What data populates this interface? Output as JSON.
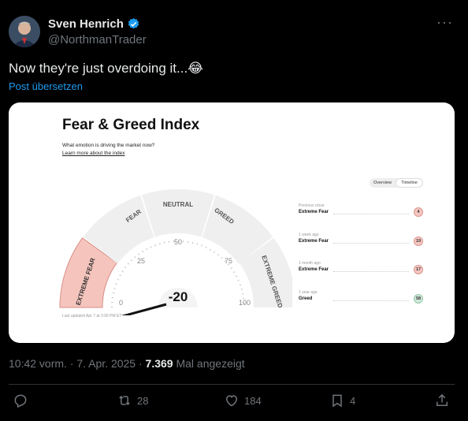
{
  "author": {
    "name": "Sven Henrich",
    "handle": "@NorthmanTrader",
    "verified_color": "#1d9bf0"
  },
  "tweet": {
    "text": "Now they're just overdoing it...😂",
    "translate_label": "Post übersetzen"
  },
  "chart": {
    "title": "Fear & Greed Index",
    "subtitle": "What emotion is driving the market now?",
    "link": "Learn more about the index",
    "toggle": [
      "Overview",
      "Timeline"
    ],
    "segments": [
      "EXTREME FEAR",
      "FEAR",
      "NEUTRAL",
      "GREED",
      "EXTREME GREED"
    ],
    "ticks": [
      "0",
      "25",
      "50",
      "75",
      "100"
    ],
    "value": "-20",
    "updated": "Last updated Apr 7 at 3:00 PM ET",
    "history": [
      {
        "label": "Previous close",
        "value": "Extreme Fear",
        "score": "4",
        "kind": "fear"
      },
      {
        "label": "1 week ago",
        "value": "Extreme Fear",
        "score": "19",
        "kind": "fear"
      },
      {
        "label": "1 month ago",
        "value": "Extreme Fear",
        "score": "17",
        "kind": "fear"
      },
      {
        "label": "1 year ago",
        "value": "Greed",
        "score": "58",
        "kind": "greed"
      }
    ]
  },
  "meta": {
    "time": "10:42 vorm. · 7. Apr. 2025 · ",
    "views": "7.369",
    "views_label": " Mal angezeigt"
  },
  "actions": {
    "reply": "",
    "retweets": "28",
    "likes": "184",
    "bookmarks": "4"
  }
}
